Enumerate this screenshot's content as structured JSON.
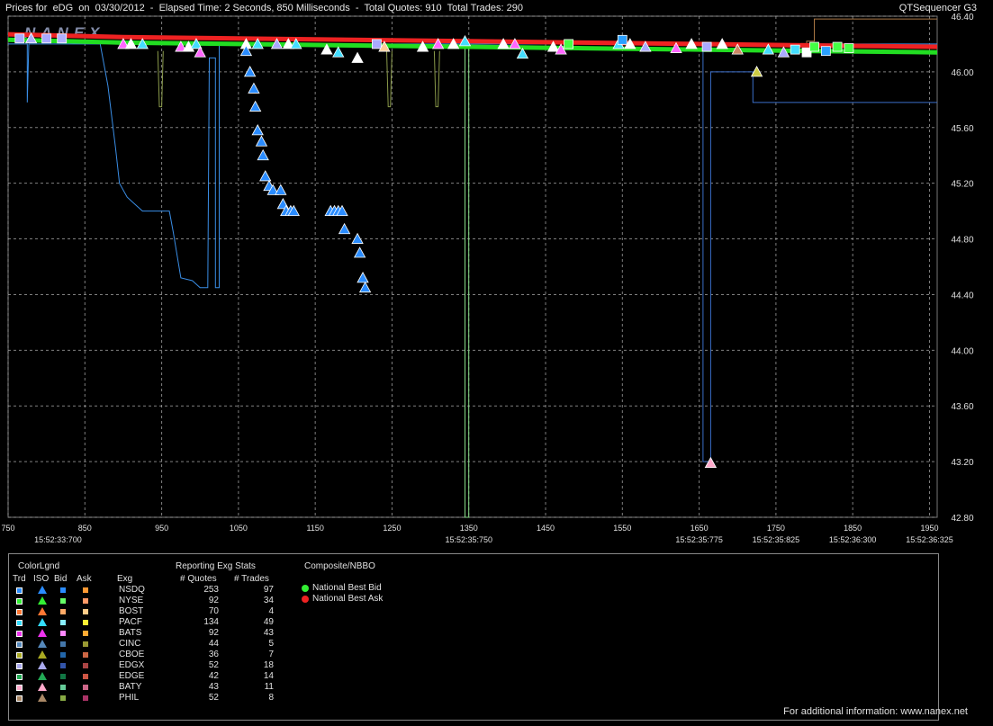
{
  "header": {
    "title": "Prices for  eDG  on  03/30/2012  -  Elapsed Time: 2 Seconds, 850 Milliseconds  -  Total Quotes: 910  Total Trades: 290",
    "app": "QTSequencer G3"
  },
  "logo_text": "NANEX",
  "chart_data": {
    "type": "scatter",
    "xlim": [
      750,
      1960
    ],
    "ylim": [
      42.8,
      46.4
    ],
    "y_ticks": [
      "46.40",
      "46.00",
      "45.60",
      "45.20",
      "44.80",
      "44.40",
      "44.00",
      "43.60",
      "43.20",
      "42.80"
    ],
    "y_tick_values": [
      46.4,
      46.0,
      45.6,
      45.2,
      44.8,
      44.4,
      44.0,
      43.6,
      43.2,
      42.8
    ],
    "x_ticks": [
      "750",
      "850",
      "950",
      "1050",
      "1150",
      "1250",
      "1350",
      "1450",
      "1550",
      "1650",
      "1750",
      "1850",
      "1950"
    ],
    "x_tick_values": [
      750,
      850,
      950,
      1050,
      1150,
      1250,
      1350,
      1450,
      1550,
      1650,
      1750,
      1850,
      1950
    ],
    "time_labels": [
      {
        "x": 815,
        "label": "15:52:33:700"
      },
      {
        "x": 1350,
        "label": "15:52:35:750"
      },
      {
        "x": 1650,
        "label": "15:52:35:775"
      },
      {
        "x": 1750,
        "label": "15:52:35:825"
      },
      {
        "x": 1850,
        "label": "15:52:36:300"
      },
      {
        "x": 1950,
        "label": "15:52:36:325"
      }
    ],
    "grid": true,
    "nbbo_bid": [
      [
        750,
        46.23
      ],
      [
        900,
        46.21
      ],
      [
        1050,
        46.2
      ],
      [
        1200,
        46.19
      ],
      [
        1350,
        46.18
      ],
      [
        1500,
        46.17
      ],
      [
        1650,
        46.16
      ],
      [
        1800,
        46.15
      ],
      [
        1960,
        46.14
      ]
    ],
    "nbbo_ask": [
      [
        750,
        46.27
      ],
      [
        900,
        46.25
      ],
      [
        1050,
        46.24
      ],
      [
        1200,
        46.23
      ],
      [
        1350,
        46.22
      ],
      [
        1500,
        46.21
      ],
      [
        1650,
        46.2
      ],
      [
        1800,
        46.19
      ],
      [
        1960,
        46.18
      ]
    ],
    "nsdq_bid_line": [
      [
        750,
        46.2
      ],
      [
        775,
        46.2
      ],
      [
        775,
        45.78
      ],
      [
        777,
        46.2
      ],
      [
        870,
        46.2
      ],
      [
        880,
        45.9
      ],
      [
        890,
        45.45
      ],
      [
        895,
        45.2
      ],
      [
        905,
        45.1
      ],
      [
        915,
        45.05
      ],
      [
        925,
        45.0
      ],
      [
        960,
        45.0
      ],
      [
        965,
        44.85
      ],
      [
        975,
        44.52
      ],
      [
        990,
        44.5
      ],
      [
        1000,
        44.45
      ],
      [
        1010,
        44.45
      ],
      [
        1012,
        46.1
      ],
      [
        1020,
        46.1
      ],
      [
        1020,
        44.45
      ],
      [
        1025,
        44.45
      ],
      [
        1025,
        46.2
      ],
      [
        1960,
        46.2
      ]
    ],
    "low_bid_line": [
      [
        1650,
        46.15
      ],
      [
        1655,
        46.15
      ],
      [
        1655,
        43.2
      ],
      [
        1665,
        43.2
      ],
      [
        1665,
        46.0
      ],
      [
        1720,
        46.0
      ],
      [
        1720,
        45.78
      ],
      [
        1960,
        45.78
      ]
    ],
    "green_spike": [
      [
        1340,
        46.18
      ],
      [
        1345,
        46.18
      ],
      [
        1345,
        42.8
      ],
      [
        1350,
        42.8
      ],
      [
        1350,
        46.18
      ]
    ],
    "olive_spike_1": [
      [
        945,
        46.15
      ],
      [
        947,
        45.75
      ],
      [
        950,
        45.75
      ],
      [
        952,
        46.15
      ]
    ],
    "olive_spike_2": [
      [
        1243,
        46.15
      ],
      [
        1245,
        45.75
      ],
      [
        1248,
        45.75
      ],
      [
        1250,
        46.15
      ]
    ],
    "olive_spike_3": [
      [
        1305,
        46.15
      ],
      [
        1307,
        45.75
      ],
      [
        1310,
        45.75
      ],
      [
        1312,
        46.15
      ]
    ],
    "brown_step": [
      [
        1790,
        46.2
      ],
      [
        1790,
        46.22
      ],
      [
        1800,
        46.22
      ],
      [
        1800,
        46.38
      ],
      [
        1960,
        46.38
      ]
    ],
    "nsdq_trades": [
      [
        1060,
        46.15
      ],
      [
        1065,
        46.0
      ],
      [
        1070,
        45.88
      ],
      [
        1072,
        45.75
      ],
      [
        1075,
        45.58
      ],
      [
        1080,
        45.5
      ],
      [
        1082,
        45.4
      ],
      [
        1085,
        45.25
      ],
      [
        1090,
        45.18
      ],
      [
        1095,
        45.15
      ],
      [
        1105,
        45.15
      ],
      [
        1108,
        45.05
      ],
      [
        1112,
        45.0
      ],
      [
        1118,
        45.0
      ],
      [
        1122,
        45.0
      ],
      [
        1170,
        45.0
      ],
      [
        1175,
        45.0
      ],
      [
        1180,
        45.0
      ],
      [
        1185,
        45.0
      ],
      [
        1188,
        44.87
      ],
      [
        1205,
        44.8
      ],
      [
        1208,
        44.7
      ],
      [
        1212,
        44.52
      ],
      [
        1215,
        44.45
      ]
    ],
    "cluster_markers": [
      {
        "x": 765,
        "y": 46.24,
        "k": "sq",
        "c": "#aaaaff"
      },
      {
        "x": 780,
        "y": 46.24,
        "k": "tri",
        "c": "#b0b0ff"
      },
      {
        "x": 800,
        "y": 46.24,
        "k": "sq",
        "c": "#aaaaff"
      },
      {
        "x": 820,
        "y": 46.24,
        "k": "sq",
        "c": "#b0b0ff"
      },
      {
        "x": 900,
        "y": 46.2,
        "k": "tri",
        "c": "#ff66ff"
      },
      {
        "x": 910,
        "y": 46.2,
        "k": "tri",
        "c": "#ffffff"
      },
      {
        "x": 925,
        "y": 46.2,
        "k": "tri",
        "c": "#44ddff"
      },
      {
        "x": 975,
        "y": 46.18,
        "k": "tri",
        "c": "#ff66ff"
      },
      {
        "x": 985,
        "y": 46.18,
        "k": "tri",
        "c": "#ffffff"
      },
      {
        "x": 995,
        "y": 46.2,
        "k": "tri",
        "c": "#44ddff"
      },
      {
        "x": 1000,
        "y": 46.14,
        "k": "tri",
        "c": "#ff66ff"
      },
      {
        "x": 1060,
        "y": 46.2,
        "k": "tri",
        "c": "#ffffff"
      },
      {
        "x": 1075,
        "y": 46.2,
        "k": "tri",
        "c": "#44ddff"
      },
      {
        "x": 1100,
        "y": 46.2,
        "k": "tri",
        "c": "#aaaaff"
      },
      {
        "x": 1115,
        "y": 46.2,
        "k": "tri",
        "c": "#ffffff"
      },
      {
        "x": 1125,
        "y": 46.2,
        "k": "tri",
        "c": "#44ddff"
      },
      {
        "x": 1165,
        "y": 46.16,
        "k": "tri",
        "c": "#ffffff"
      },
      {
        "x": 1180,
        "y": 46.14,
        "k": "tri",
        "c": "#44ddff"
      },
      {
        "x": 1205,
        "y": 46.1,
        "k": "tri",
        "c": "#ffffff"
      },
      {
        "x": 1230,
        "y": 46.2,
        "k": "sq",
        "c": "#aaaaff"
      },
      {
        "x": 1240,
        "y": 46.18,
        "k": "tri",
        "c": "#ffcc99"
      },
      {
        "x": 1290,
        "y": 46.18,
        "k": "tri",
        "c": "#ffffff"
      },
      {
        "x": 1310,
        "y": 46.2,
        "k": "tri",
        "c": "#ff66ff"
      },
      {
        "x": 1330,
        "y": 46.2,
        "k": "tri",
        "c": "#ffffff"
      },
      {
        "x": 1345,
        "y": 46.22,
        "k": "tri",
        "c": "#44ddff"
      },
      {
        "x": 1395,
        "y": 46.2,
        "k": "tri",
        "c": "#ffffff"
      },
      {
        "x": 1410,
        "y": 46.2,
        "k": "tri",
        "c": "#ff66ff"
      },
      {
        "x": 1420,
        "y": 46.13,
        "k": "tri",
        "c": "#44ddff"
      },
      {
        "x": 1460,
        "y": 46.18,
        "k": "tri",
        "c": "#ffffff"
      },
      {
        "x": 1470,
        "y": 46.16,
        "k": "tri",
        "c": "#ff66ff"
      },
      {
        "x": 1480,
        "y": 46.2,
        "k": "sq",
        "c": "#44ff44"
      },
      {
        "x": 1545,
        "y": 46.2,
        "k": "tri",
        "c": "#44ddff"
      },
      {
        "x": 1550,
        "y": 46.23,
        "k": "sq",
        "c": "#2aa0ff"
      },
      {
        "x": 1560,
        "y": 46.2,
        "k": "tri",
        "c": "#ffffff"
      },
      {
        "x": 1580,
        "y": 46.18,
        "k": "tri",
        "c": "#aaaaff"
      },
      {
        "x": 1620,
        "y": 46.17,
        "k": "tri",
        "c": "#ff66ff"
      },
      {
        "x": 1640,
        "y": 46.2,
        "k": "tri",
        "c": "#ffffff"
      },
      {
        "x": 1660,
        "y": 46.18,
        "k": "sq",
        "c": "#aaaaff"
      },
      {
        "x": 1680,
        "y": 46.2,
        "k": "tri",
        "c": "#ffffff"
      },
      {
        "x": 1700,
        "y": 46.16,
        "k": "tri",
        "c": "#cc8866"
      },
      {
        "x": 1725,
        "y": 46.0,
        "k": "tri",
        "c": "#cccc44"
      },
      {
        "x": 1740,
        "y": 46.16,
        "k": "tri",
        "c": "#44ddff"
      },
      {
        "x": 1760,
        "y": 46.14,
        "k": "tri",
        "c": "#aaaaff"
      },
      {
        "x": 1775,
        "y": 46.16,
        "k": "sq",
        "c": "#44ddff"
      },
      {
        "x": 1790,
        "y": 46.14,
        "k": "sq",
        "c": "#ffffff"
      },
      {
        "x": 1800,
        "y": 46.18,
        "k": "sq",
        "c": "#44ff44"
      },
      {
        "x": 1815,
        "y": 46.15,
        "k": "sq",
        "c": "#2aa0ff"
      },
      {
        "x": 1830,
        "y": 46.18,
        "k": "sq",
        "c": "#44ff44"
      },
      {
        "x": 1845,
        "y": 46.17,
        "k": "sq",
        "c": "#44ff44"
      },
      {
        "x": 1665,
        "y": 43.19,
        "k": "tri",
        "c": "#ffaacc"
      }
    ]
  },
  "legend": {
    "color_legend_title": "ColorLgnd",
    "col_trd": "Trd",
    "col_iso": "ISO",
    "col_bid": "Bid",
    "col_ask": "Ask",
    "col_exg": "Exg",
    "stats_title": "Reporting Exg Stats",
    "col_quotes": "# Quotes",
    "col_trades": "# Trades",
    "rows": [
      {
        "exg": "NSDQ",
        "quotes": "253",
        "trades": "97",
        "trd": "#2a8cff",
        "iso": "#2a8cff",
        "bid": "#2a8cff",
        "ask": "#ff9933"
      },
      {
        "exg": "NYSE",
        "quotes": "92",
        "trades": "34",
        "trd": "#33ee33",
        "iso": "#33ee33",
        "bid": "#66ff66",
        "ask": "#ff9966"
      },
      {
        "exg": "BOST",
        "quotes": "70",
        "trades": "4",
        "trd": "#ff7733",
        "iso": "#ff7733",
        "bid": "#ffaa66",
        "ask": "#ffcc88"
      },
      {
        "exg": "PACF",
        "quotes": "134",
        "trades": "49",
        "trd": "#33ddff",
        "iso": "#33ddff",
        "bid": "#88eeff",
        "ask": "#ffee33"
      },
      {
        "exg": "BATS",
        "quotes": "92",
        "trades": "43",
        "trd": "#ee33ee",
        "iso": "#ee33ee",
        "bid": "#ff88ff",
        "ask": "#ffaa33"
      },
      {
        "exg": "CINC",
        "quotes": "44",
        "trades": "5",
        "trd": "#5588bb",
        "iso": "#5588bb",
        "bid": "#4477aa",
        "ask": "#999933"
      },
      {
        "exg": "CBOE",
        "quotes": "36",
        "trades": "7",
        "trd": "#aaaa22",
        "iso": "#aaaa22",
        "bid": "#2266aa",
        "ask": "#cc6644"
      },
      {
        "exg": "EDGX",
        "quotes": "52",
        "trades": "18",
        "trd": "#aaaaee",
        "iso": "#aaaaee",
        "bid": "#3355aa",
        "ask": "#aa4444"
      },
      {
        "exg": "EDGE",
        "quotes": "42",
        "trades": "14",
        "trd": "#22aa55",
        "iso": "#22aa55",
        "bid": "#117744",
        "ask": "#cc5544"
      },
      {
        "exg": "BATY",
        "quotes": "43",
        "trades": "11",
        "trd": "#ffaacc",
        "iso": "#ffaacc",
        "bid": "#66cc99",
        "ask": "#cc6688"
      },
      {
        "exg": "PHIL",
        "quotes": "52",
        "trades": "8",
        "trd": "#aa8866",
        "iso": "#aa8866",
        "bid": "#88aa44",
        "ask": "#aa3366"
      }
    ],
    "composite_title": "Composite/NBBO",
    "nbbo_bid_label": "National Best Bid",
    "nbbo_ask_label": "National Best Ask",
    "nbbo_bid_color": "#33ee33",
    "nbbo_ask_color": "#ee2222"
  },
  "footer": {
    "info": "For additional information: www.nanex.net"
  }
}
